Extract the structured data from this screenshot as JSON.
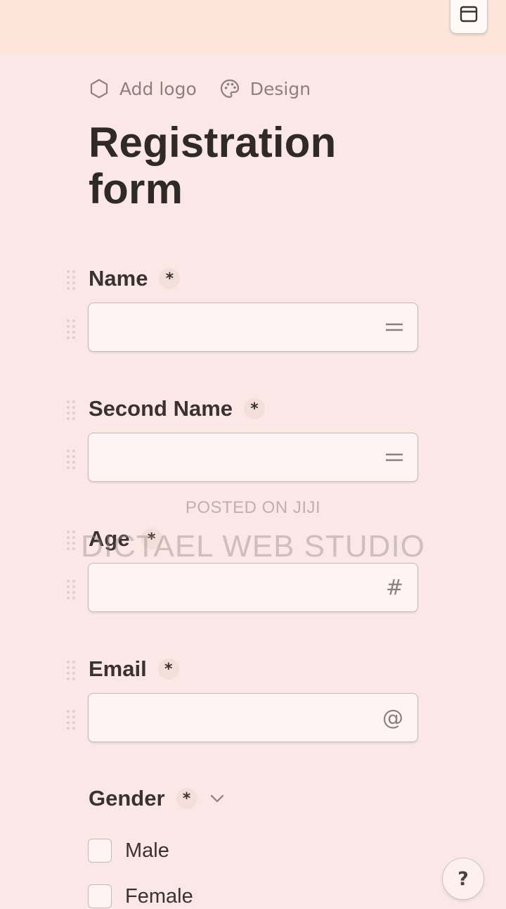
{
  "toolbar": {
    "add_logo_label": "Add logo",
    "design_label": "Design"
  },
  "form": {
    "title": "Registration form",
    "required_mark": "*",
    "questions": [
      {
        "label": "Name",
        "required": true,
        "type": "text",
        "icon": "short-text-icon"
      },
      {
        "label": "Second Name",
        "required": true,
        "type": "text",
        "icon": "short-text-icon"
      },
      {
        "label": "Age",
        "required": true,
        "type": "number",
        "icon": "hash-icon",
        "icon_glyph": "#"
      },
      {
        "label": "Email",
        "required": true,
        "type": "email",
        "icon": "at-icon",
        "icon_glyph": "@"
      },
      {
        "label": "Gender",
        "required": true,
        "type": "checkboxes",
        "icon": "chevron-down-icon",
        "options": [
          "Male",
          "Female"
        ]
      }
    ]
  },
  "watermark": {
    "line1": "POSTED ON JIJI",
    "line2": "DICTAEL WEB STUDIO"
  },
  "help": {
    "label": "?"
  },
  "colors": {
    "background": "#fbe8e6",
    "banner": "#fde5da",
    "title": "#2f2927",
    "muted": "#8b807c"
  }
}
